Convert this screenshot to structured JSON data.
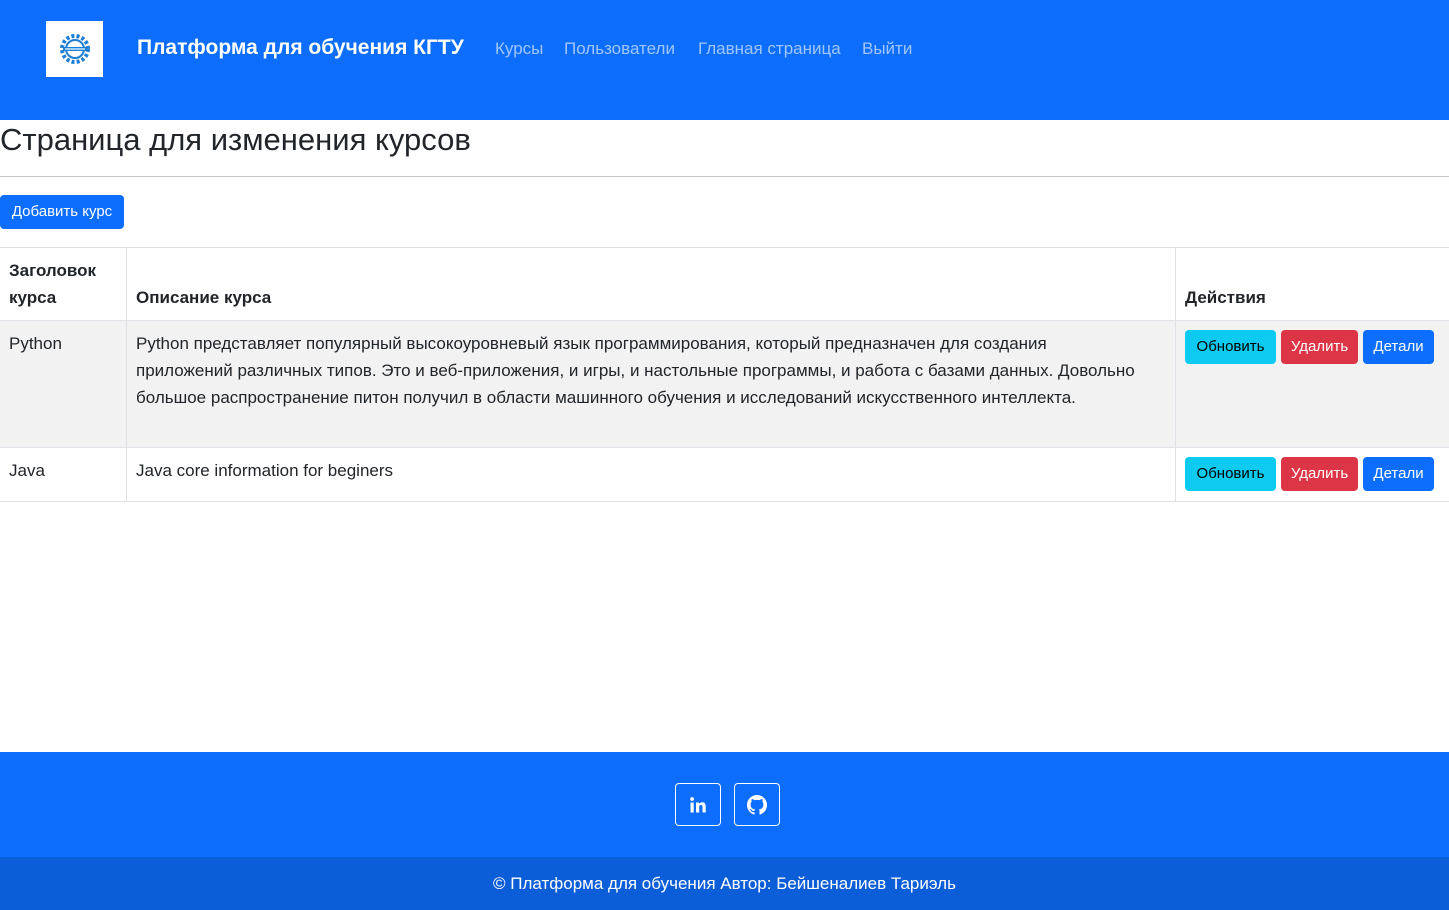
{
  "navbar": {
    "brand": "Платформа для обучения КГТУ",
    "links": [
      {
        "label": "Курсы"
      },
      {
        "label": "Пользователи"
      },
      {
        "label": "Главная страница"
      },
      {
        "label": "Выйти"
      }
    ],
    "logo_icon": "gear-logo-icon"
  },
  "page": {
    "title": "Страница для изменения курсов",
    "add_button": "Добавить курс"
  },
  "table": {
    "headers": {
      "title": "Заголовок курса",
      "description": "Описание курса",
      "actions": "Действия"
    },
    "rows": [
      {
        "title": "Python",
        "description": "Python представляет популярный высокоуровневый язык программирования, который предназначен для создания приложений различных типов. Это и веб-приложения, и игры, и настольные программы, и работа с базами данных. Довольно большое распространение питон получил в области машинного обучения и исследований искусственного интеллекта.",
        "update": "Обновить",
        "delete": "Удалить",
        "details": "Детали"
      },
      {
        "title": "Java",
        "description": "Java core information for beginers",
        "update": "Обновить",
        "delete": "Удалить",
        "details": "Детали"
      }
    ]
  },
  "footer": {
    "social": [
      {
        "icon": "linkedin-icon"
      },
      {
        "icon": "github-icon"
      }
    ],
    "copyright": "© Платформа для обучения Автор: Бейшеналиев Тариэль"
  },
  "colors": {
    "primary": "#0d6efd",
    "info": "#0dcaf0",
    "danger": "#dc3545",
    "footer_bottom": "#0b5ed7",
    "striped_row": "#f2f2f2"
  }
}
